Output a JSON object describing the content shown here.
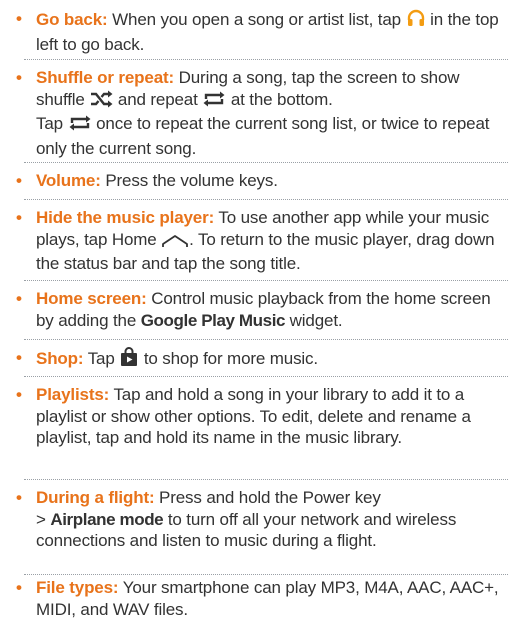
{
  "bullet": "•",
  "colors": {
    "accent": "#e8731b",
    "text": "#333333",
    "play_icon": "#f39c12"
  },
  "tips": [
    {
      "term": "Go back:",
      "text_1": "When you open a song or artist list, tap",
      "icon": "headphones-icon",
      "text_2": "in the top left to go back."
    },
    {
      "term": "Shuffle or repeat:",
      "text_1": "During a song, tap the screen to show shuffle",
      "icon_1": "shuffle-icon",
      "text_2": "and repeat",
      "icon_2": "repeat-icon",
      "text_3": "at the bottom.",
      "text_4": "Tap",
      "icon_3": "repeat-icon",
      "text_5": "once to repeat the current song list, or twice to repeat only the current song."
    },
    {
      "term": "Volume:",
      "text_1": "Press the volume keys."
    },
    {
      "term": "Hide the music player:",
      "text_1": "To use another app while your music plays, tap Home",
      "icon": "home-icon",
      "text_2": ". To return to the music player, drag down the status bar and tap the song title."
    },
    {
      "term": "Home screen:",
      "text_1": "Control music playback from the home screen by adding the",
      "ui_1": "Google Play Music",
      "text_2": "widget."
    },
    {
      "term": "Shop:",
      "text_1": "Tap",
      "icon": "play-store-icon",
      "text_2": "to shop for more music."
    },
    {
      "term": "Playlists:",
      "text_1": "Tap and hold a song in your library to add it to a playlist or show other options. To edit, delete and rename a playlist, tap and hold its name in the music library."
    },
    {
      "term": "During a flight:",
      "text_1": "Press and hold the Power key",
      "text_2": ">",
      "ui_1": "Airplane mode",
      "text_3": "to turn off all your network and wireless connections and listen to music during a flight."
    },
    {
      "term": "File types:",
      "text_1": "Your smartphone can play MP3, M4A, AAC, AAC+, MIDI, and WAV files."
    }
  ]
}
